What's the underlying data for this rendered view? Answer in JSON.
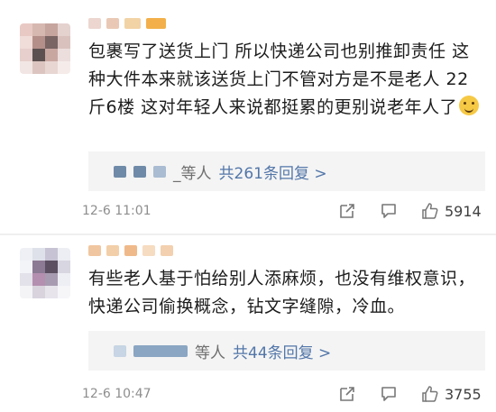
{
  "comments": [
    {
      "text": "包裹写了送货上门 所以快递公司也别推卸责任 这种大件本来就该送货上门不管对方是不是老人 22斤6楼 这对年轻人来说都挺累的更别说老年人了",
      "emoji": "hugging-emoji",
      "reply_suffix": "_等人",
      "reply_link": "共261条回复 >",
      "time": "12-6 11:01",
      "likes": "5914"
    },
    {
      "text": "有些老人基于怕给别人添麻烦，也没有维权意识，快递公司偷换概念，钻文字缝隙，冷血。",
      "reply_suffix": "等人",
      "reply_link": "共44条回复 >",
      "time": "12-6 10:47",
      "likes": "3755"
    }
  ],
  "colors": {
    "link": "#5276a9",
    "meta": "#8e8e8e",
    "reply_bg": "#f4f4f4"
  }
}
